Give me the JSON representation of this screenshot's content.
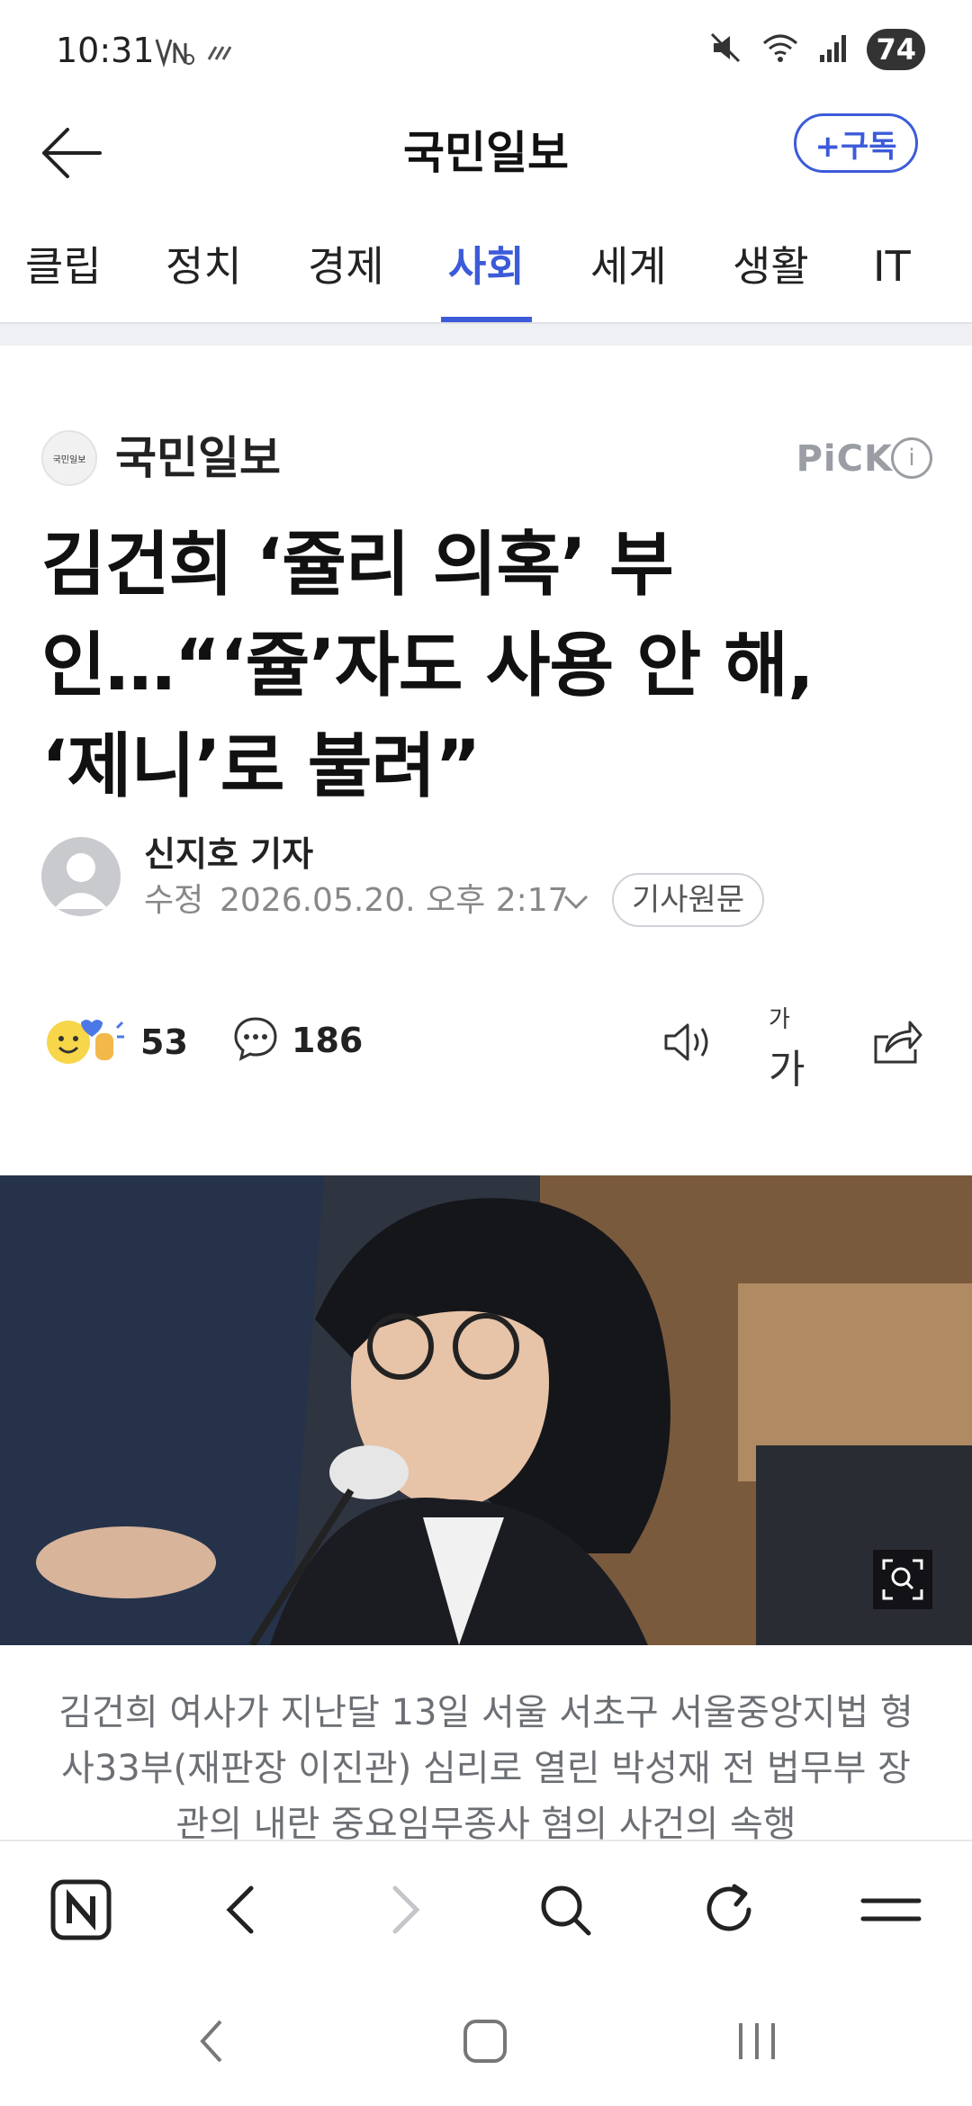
{
  "status_bar": {
    "time": "10:31",
    "battery": "74",
    "icons": [
      "nfc-icon",
      "data-icon",
      "mute-icon",
      "wifi-icon",
      "signal-icon"
    ]
  },
  "header": {
    "title": "국민일보",
    "subscribe": "+구독"
  },
  "tabs": [
    {
      "label": "클립",
      "active": false
    },
    {
      "label": "정치",
      "active": false
    },
    {
      "label": "경제",
      "active": false
    },
    {
      "label": "사회",
      "active": true
    },
    {
      "label": "세계",
      "active": false
    },
    {
      "label": "생활",
      "active": false
    },
    {
      "label": "IT",
      "active": false
    }
  ],
  "article": {
    "press_name": "국민일보",
    "press_logo_text": "국민일보",
    "pick": "PiCK",
    "headline_lines": [
      "김건희 ‘쥴리 의혹’ 부",
      "인…“‘쥴’자도 사용 안 해,",
      "‘제니’로 불려”"
    ],
    "reporter": "신지호 기자",
    "edit_label": "수정",
    "edit_date": "2026.05.20. 오후 2:17",
    "original_button": "기사원문",
    "reaction_count": "53",
    "comment_count": "186",
    "caption": "김건희 여사가 지난달 13일 서울 서초구 서울중앙지법 형사33부(재판장 이진관) 심리로 열린 박성재 전 법무부 장관의 내란 중요임무종사 혐의 사건의 속행"
  },
  "colors": {
    "accent": "#3c5bd9",
    "muted": "#9a9da3",
    "caption": "#6c6f74"
  }
}
